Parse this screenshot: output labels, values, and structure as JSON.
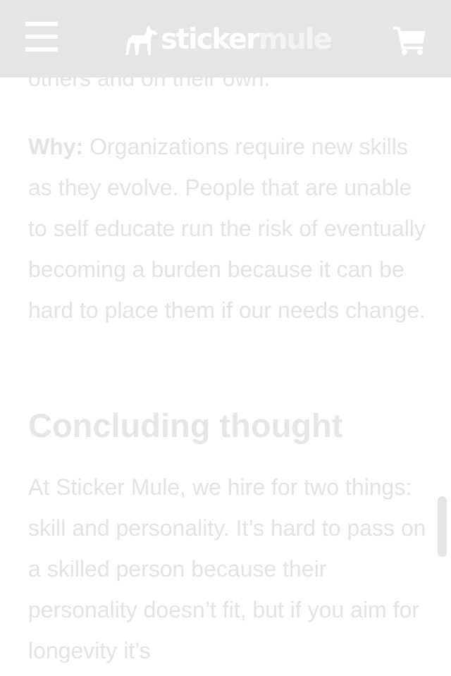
{
  "header": {
    "logo_sticker": "sticker",
    "logo_mule": "mule",
    "menu_icon": "hamburger-menu-icon",
    "cart_icon": "shopping-cart-icon",
    "background": "#e5e5e5"
  },
  "article": {
    "partial_line": "others and on their own.",
    "why_label": "Why:",
    "why_text": " Organizations require new skills as they evolve. People that are unable to self educate run the risk of eventually becoming a burden because it can be hard to place them if our needs change.",
    "heading": "Concluding thought",
    "conclusion_text": "At Sticker Mule, we hire for two things: skill and personality. It’s hard to pass on a skilled person because their personality doesn’t fit, but if you aim for longevity it’s",
    "text_color": "#e3e3e3"
  }
}
